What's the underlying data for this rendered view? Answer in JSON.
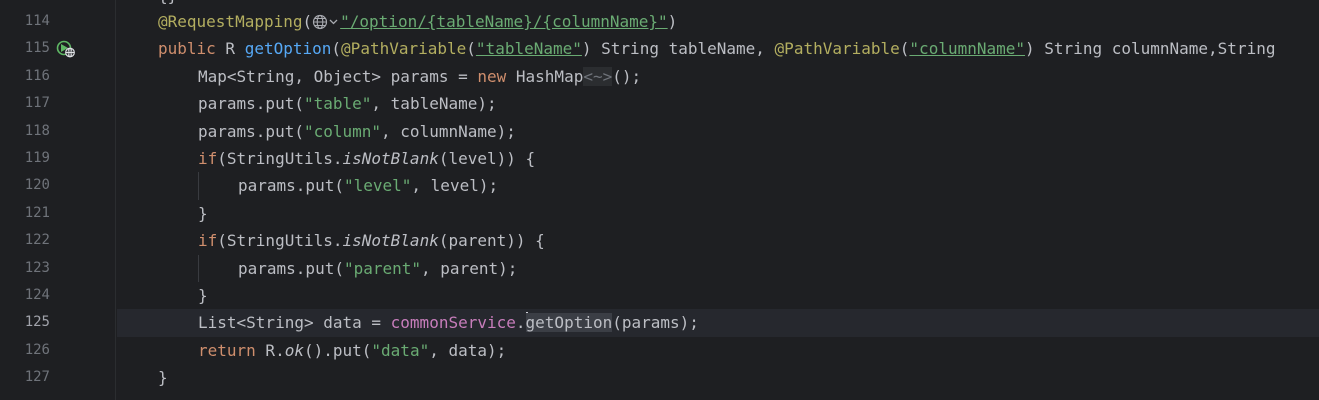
{
  "editor": {
    "lines": [
      {
        "n": "114"
      },
      {
        "n": "115"
      },
      {
        "n": "116"
      },
      {
        "n": "117"
      },
      {
        "n": "118"
      },
      {
        "n": "119"
      },
      {
        "n": "120"
      },
      {
        "n": "121"
      },
      {
        "n": "122"
      },
      {
        "n": "123"
      },
      {
        "n": "124"
      },
      {
        "n": "125"
      },
      {
        "n": "126"
      },
      {
        "n": "127"
      }
    ],
    "current_line": "125",
    "tokens": {
      "l114": {
        "ann": "@RequestMapping",
        "p1": "(",
        "str": "\"/option/{tableName}/{columnName}\"",
        "p2": ")"
      },
      "l115": {
        "kw": "public",
        "t1": " R ",
        "fn": "getOption",
        "t2": "(",
        "ann1": "@PathVariable",
        "t3": "(",
        "s1": "\"tableName\"",
        "t4": ") String tableName, ",
        "ann2": "@PathVariable",
        "t5": "(",
        "s2": "\"columnName\"",
        "t6": ") String columnName,String"
      },
      "l116": {
        "t1": "Map<String, Object> params = ",
        "kw": "new",
        "t2": " HashMap",
        "diamond": "<~>",
        "t3": "();"
      },
      "l117": {
        "t1": "params.put(",
        "s": "\"table\"",
        "t2": ", tableName);"
      },
      "l118": {
        "t1": "params.put(",
        "s": "\"column\"",
        "t2": ", columnName);"
      },
      "l119": {
        "kw": "if",
        "t1": "(StringUtils.",
        "it": "isNotBlank",
        "t2": "(level)) {"
      },
      "l120": {
        "t1": "params.put(",
        "s": "\"level\"",
        "t2": ", level);"
      },
      "l121": {
        "t1": "}"
      },
      "l122": {
        "kw": "if",
        "t1": "(StringUtils.",
        "it": "isNotBlank",
        "t2": "(parent)) {"
      },
      "l123": {
        "t1": "params.put(",
        "s": "\"parent\"",
        "t2": ", parent);"
      },
      "l124": {
        "t1": "}"
      },
      "l125": {
        "t1": "List<String> data = ",
        "field": "commonService",
        "dot": ".",
        "hl": "getOption",
        "t2": "(params);"
      },
      "l126": {
        "kw": "return",
        "t1": " R.",
        "it": "ok",
        "t2": "().put(",
        "s": "\"data\"",
        "t3": ", data);"
      },
      "l127": {
        "t1": "}"
      }
    }
  },
  "colors": {
    "background": "#1e1f22",
    "keyword": "#cf8e6d",
    "annotation": "#b3ae60",
    "string": "#6aab73",
    "function": "#56a8f5",
    "field": "#c77dbb",
    "text": "#bcbec4",
    "line_number": "#6f737a"
  },
  "icons": [
    "globe-icon",
    "chevron-down-icon",
    "run-gutter-icon"
  ]
}
